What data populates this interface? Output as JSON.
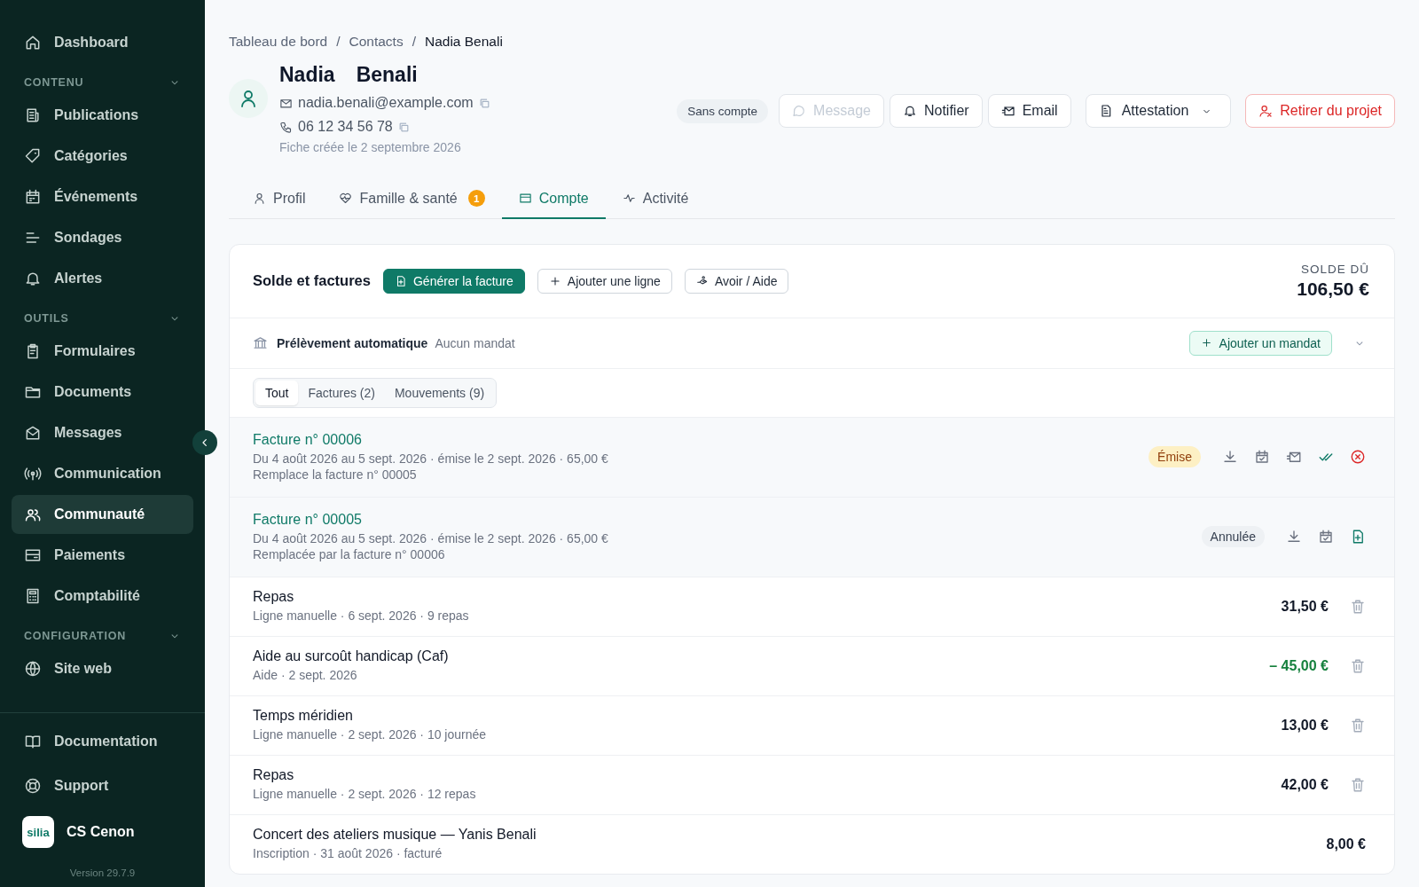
{
  "sidebar": {
    "top_item": {
      "label": "Dashboard",
      "selected": false
    },
    "sections": [
      {
        "title": "CONTENU",
        "expanded": true,
        "items": [
          {
            "label": "Publications",
            "selected": false
          },
          {
            "label": "Catégories",
            "selected": false
          },
          {
            "label": "Événements",
            "selected": false
          },
          {
            "label": "Sondages",
            "selected": false
          },
          {
            "label": "Alertes",
            "selected": false
          }
        ]
      },
      {
        "title": "OUTILS",
        "expanded": true,
        "items": [
          {
            "label": "Formulaires",
            "selected": false
          },
          {
            "label": "Documents",
            "selected": false
          },
          {
            "label": "Messages",
            "selected": false
          },
          {
            "label": "Communication",
            "selected": false
          },
          {
            "label": "Communauté",
            "selected": true
          },
          {
            "label": "Paiements",
            "selected": false
          },
          {
            "label": "Comptabilité",
            "selected": false
          }
        ]
      },
      {
        "title": "CONFIGURATION",
        "expanded": true,
        "items": [
          {
            "label": "Site web",
            "selected": false
          }
        ]
      }
    ],
    "footer_items": [
      {
        "label": "Documentation"
      },
      {
        "label": "Support"
      }
    ],
    "organization": {
      "logo": "silia",
      "name": "CS Cenon"
    },
    "version": "Version 29.7.9"
  },
  "breadcrumb": {
    "separator": "/",
    "items": [
      "Tableau de bord",
      "Contacts",
      "Nadia Benali"
    ]
  },
  "contact": {
    "first_name": "Nadia",
    "last_name": "Benali",
    "email": "nadia.benali@example.com",
    "phone": "06 12 34 56 78",
    "created": "Fiche créée le 2 septembre 2026",
    "account_status": "Sans compte"
  },
  "header_buttons": [
    {
      "label": "Message",
      "kind": "message",
      "disabled": true
    },
    {
      "label": "Notifier",
      "kind": "notify",
      "disabled": false
    },
    {
      "label": "Email",
      "kind": "email",
      "disabled": false
    },
    {
      "label": "Attestation",
      "kind": "dropdown",
      "disabled": false
    },
    {
      "label": "Retirer du projet",
      "kind": "danger",
      "disabled": false
    }
  ],
  "tabs": [
    {
      "label": "Profil",
      "selected": false
    },
    {
      "label": "Famille & santé",
      "selected": false,
      "badge": "1"
    },
    {
      "label": "Compte",
      "selected": true
    },
    {
      "label": "Activité",
      "selected": false
    }
  ],
  "account": {
    "title": "Solde et factures",
    "actions": [
      {
        "label": "Générer la facture",
        "kind": "primary"
      },
      {
        "label": "Ajouter une ligne",
        "kind": "add"
      },
      {
        "label": "Avoir / Aide",
        "kind": "credit"
      }
    ],
    "balance_label": "SOLDE DÛ",
    "balance": "106,50 €",
    "direct_debit": {
      "label": "Prélèvement automatique",
      "value": "Aucun mandat",
      "button": "Ajouter un mandat",
      "expanded": false
    },
    "filters": [
      {
        "label": "Tout",
        "selected": true
      },
      {
        "label": "Factures (2)",
        "selected": false
      },
      {
        "label": "Mouvements (9)",
        "selected": false
      }
    ],
    "rows": [
      {
        "kind": "invoice",
        "title": "Facture n° 00006",
        "details": "Du 4 août 2026 au 5 sept. 2026 · émise le 2 sept. 2026 · 65,00 €",
        "note": "Remplace la facture n° 00005",
        "status": {
          "label": "Émise",
          "kind": "issued"
        }
      },
      {
        "kind": "invoice",
        "title": "Facture n° 00005",
        "details": "Du 4 août 2026 au 5 sept. 2026 · émise le 2 sept. 2026 · 65,00 €",
        "note": "Remplacée par la facture n° 00006",
        "status": {
          "label": "Annulée",
          "kind": "cancelled"
        }
      },
      {
        "kind": "entry",
        "title": "Repas",
        "subtitle": "Ligne manuelle · 6 sept. 2026 · 9 repas",
        "amount": "31,50 €",
        "credit": false,
        "deletable": true
      },
      {
        "kind": "entry",
        "title": "Aide au surcoût handicap (Caf)",
        "subtitle": "Aide · 2 sept. 2026",
        "amount": "– 45,00 €",
        "credit": true,
        "deletable": true
      },
      {
        "kind": "entry",
        "title": "Temps méridien",
        "subtitle": "Ligne manuelle · 2 sept. 2026 · 10 journée",
        "amount": "13,00 €",
        "credit": false,
        "deletable": true
      },
      {
        "kind": "entry",
        "title": "Repas",
        "subtitle": "Ligne manuelle · 2 sept. 2026 · 12 repas",
        "amount": "42,00 €",
        "credit": false,
        "deletable": true
      },
      {
        "kind": "entry",
        "title": "Concert des ateliers musique — Yanis Benali",
        "subtitle": "Inscription · 31 août 2026 · facturé",
        "amount": "8,00 €",
        "credit": false,
        "deletable": false
      }
    ]
  }
}
